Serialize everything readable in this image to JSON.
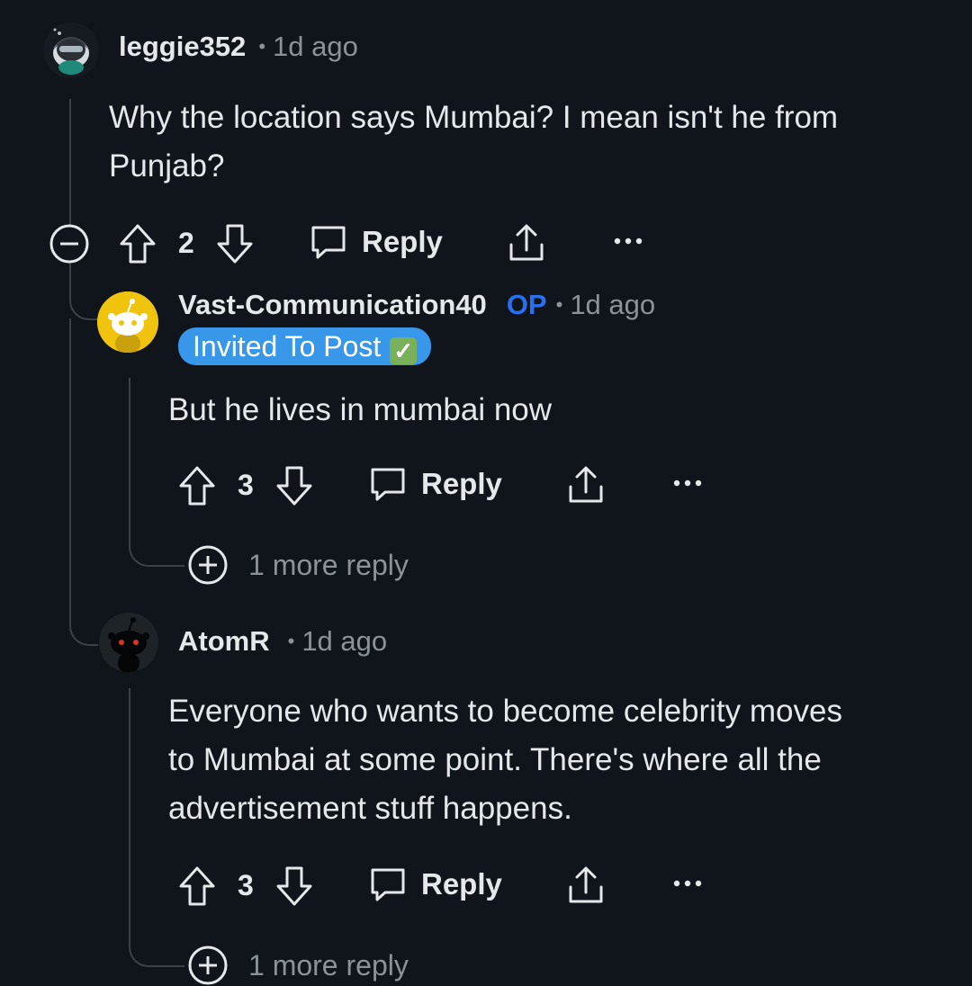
{
  "comments": [
    {
      "username": "leggie352",
      "time": "1d ago",
      "body": "Why the location says Mumbai? I mean isn't he from Punjab?",
      "body_lines": [
        "Why the location says Mumbai? I mean isn't he from",
        "Punjab?"
      ],
      "votes": "2",
      "reply_label": "Reply",
      "avatar_icon": "snoo-avatar-dark-icon"
    },
    {
      "username": "Vast-Communication40",
      "op_label": "OP",
      "time": "1d ago",
      "flair": "Invited To Post",
      "flair_emoji": "✅",
      "body": "But he lives in mumbai now",
      "votes": "3",
      "reply_label": "Reply",
      "more_replies": "1 more reply",
      "avatar_icon": "snoo-avatar-yellow-icon"
    },
    {
      "username": "AtomR",
      "time": "1d ago",
      "body": "Everyone who wants to become celebrity moves to Mumbai at some point. There's where all the advertisement stuff happens.",
      "body_lines": [
        "Everyone who wants to become celebrity moves",
        "to Mumbai at some point. There's where all the",
        "advertisement stuff happens."
      ],
      "votes": "3",
      "reply_label": "Reply",
      "more_replies": "1 more reply",
      "avatar_icon": "snoo-avatar-black-icon"
    }
  ],
  "colors": {
    "background": "#0f151a",
    "text": "#e5e8ea",
    "muted": "#8b9399",
    "op": "#2a6ff0",
    "flair_bg": "#3897e8",
    "thread_line": "#3a4248"
  }
}
